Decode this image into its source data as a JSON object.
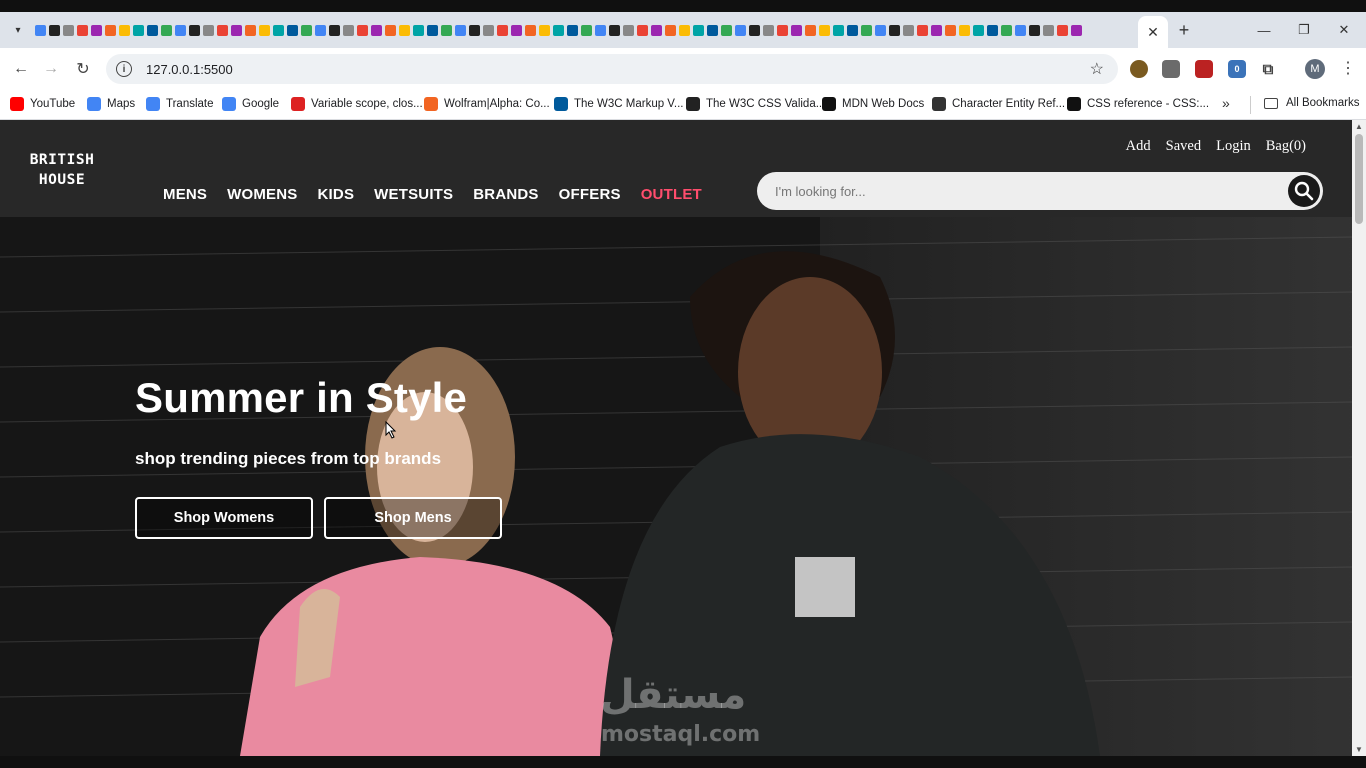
{
  "browser": {
    "active_tab_close": "✕",
    "new_tab": "+",
    "window_minimize": "—",
    "window_restore": "❐",
    "window_close": "✕",
    "url": "127.0.0.1:5500",
    "profile_initial": "M",
    "extension_badge": "0",
    "bookmarks": [
      {
        "label": "YouTube",
        "icon": "youtube-icon",
        "color": "#ff0000"
      },
      {
        "label": "Maps",
        "icon": "google-icon",
        "color": "#4285f4"
      },
      {
        "label": "Translate",
        "icon": "translate-icon",
        "color": "#4285f4"
      },
      {
        "label": "Google",
        "icon": "google-icon",
        "color": "#4285f4"
      },
      {
        "label": "Variable scope, clos...",
        "icon": "mdn-icon",
        "color": "#d22"
      },
      {
        "label": "Wolfram|Alpha: Co...",
        "icon": "wolfram-icon",
        "color": "#f26522"
      },
      {
        "label": "The W3C Markup V...",
        "icon": "w3c-icon",
        "color": "#005a9c"
      },
      {
        "label": "The W3C CSS Valida...",
        "icon": "w3c-css-icon",
        "color": "#222"
      },
      {
        "label": "MDN Web Docs",
        "icon": "mdn-icon",
        "color": "#111"
      },
      {
        "label": "Character Entity Ref...",
        "icon": "help-icon",
        "color": "#333"
      },
      {
        "label": "CSS reference - CSS:...",
        "icon": "mdn-icon",
        "color": "#111"
      }
    ],
    "bookmarks_more": "»",
    "all_bookmarks": "All Bookmarks"
  },
  "site": {
    "logo_line1": "BRITISH",
    "logo_line2": "HOUSE",
    "nav": [
      "MENS",
      "WOMENS",
      "KIDS",
      "WETSUITS",
      "BRANDS",
      "OFFERS",
      "OUTLET"
    ],
    "util": [
      "Add",
      "Saved",
      "Login",
      "Bag(0)"
    ],
    "search_placeholder": "I'm looking for...",
    "hero": {
      "title": "Summer in Style",
      "subtitle": "shop trending pieces from top brands",
      "btn_women": "Shop Womens",
      "btn_men": "Shop Mens"
    },
    "watermark_ar": "مستقل",
    "watermark_en": "mostaql.com"
  },
  "colors": {
    "header_bg": "#282828",
    "outlet": "#ff4d6d",
    "search_bg": "#eeeeee"
  }
}
